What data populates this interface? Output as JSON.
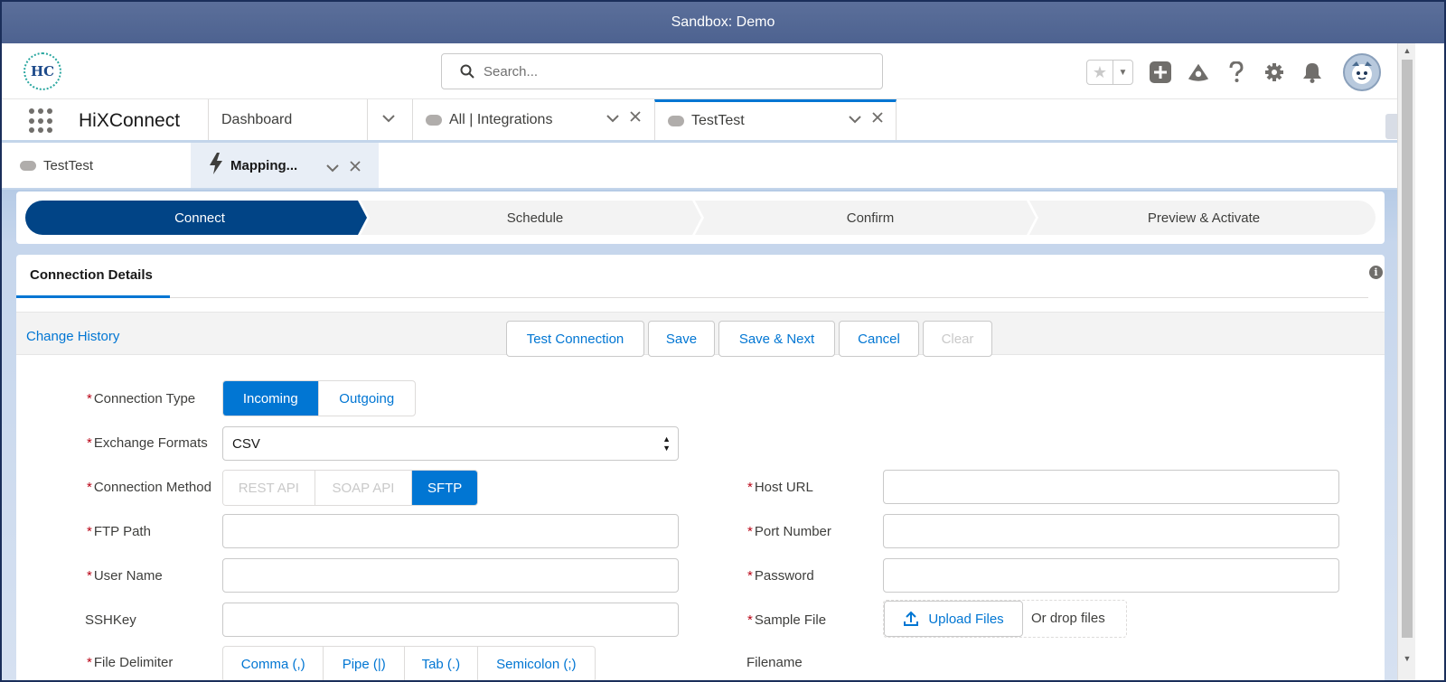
{
  "banner": {
    "text": "Sandbox: Demo"
  },
  "header": {
    "logo_text": "HC",
    "search_placeholder": "Search..."
  },
  "nav": {
    "app_name": "HiXConnect",
    "tabs": [
      {
        "label": "Dashboard"
      },
      {
        "label": "All | Integrations"
      },
      {
        "label": "TestTest"
      }
    ]
  },
  "subtabs": [
    {
      "label": "TestTest"
    },
    {
      "label": "Mapping..."
    }
  ],
  "path": {
    "steps": [
      "Connect",
      "Schedule",
      "Confirm",
      "Preview & Activate"
    ],
    "active_index": 0
  },
  "card": {
    "tab_label": "Connection Details",
    "change_history": "Change History",
    "buttons": {
      "test": "Test Connection",
      "save": "Save",
      "save_next": "Save & Next",
      "cancel": "Cancel",
      "clear": "Clear"
    }
  },
  "form": {
    "connection_type": {
      "label": "Connection Type",
      "options": [
        "Incoming",
        "Outgoing"
      ],
      "selected": "Incoming"
    },
    "exchange_formats": {
      "label": "Exchange Formats",
      "value": "CSV"
    },
    "connection_method": {
      "label": "Connection Method",
      "options": [
        "REST API",
        "SOAP API",
        "SFTP"
      ],
      "selected": "SFTP"
    },
    "ftp_path": {
      "label": "FTP Path",
      "value": ""
    },
    "user_name": {
      "label": "User Name",
      "value": ""
    },
    "ssh_key": {
      "label": "SSHKey",
      "value": ""
    },
    "file_delimiter": {
      "label": "File Delimiter",
      "options": [
        "Comma (,)",
        "Pipe (|)",
        "Tab (.)",
        "Semicolon (;)"
      ]
    },
    "host_url": {
      "label": "Host URL",
      "value": ""
    },
    "port_number": {
      "label": "Port Number",
      "value": ""
    },
    "password": {
      "label": "Password",
      "value": ""
    },
    "sample_file": {
      "label": "Sample File",
      "upload_label": "Upload Files",
      "drop_label": "Or drop files"
    },
    "filename": {
      "label": "Filename"
    }
  },
  "colors": {
    "brand": "#0176d3",
    "path_active": "#014486",
    "required": "#ba0517"
  }
}
